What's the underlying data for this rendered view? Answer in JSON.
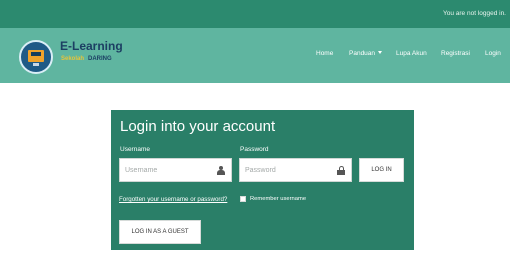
{
  "topbar": {
    "status_text": "You are not logged in."
  },
  "brand": {
    "title": "E-Learning",
    "sub1": "Sekolah",
    "sub2": "DARING"
  },
  "nav": {
    "home": "Home",
    "panduan": "Panduan",
    "lupa_akun": "Lupa Akun",
    "registrasi": "Registrasi",
    "login": "Login"
  },
  "login_card": {
    "title": "Login into your account",
    "username_label": "Username",
    "password_label": "Password",
    "username_placeholder": "Username",
    "password_placeholder": "Password",
    "login_button": "LOG IN",
    "forgot_link": "Forgotten your username or password?",
    "remember_label": "Remember username",
    "guest_button": "LOG IN AS A GUEST"
  },
  "colors": {
    "topbar": "#2c8a6f",
    "navbar": "#5fb5a0",
    "card": "#2a7f68",
    "brand_title": "#1c3f63",
    "brand_sub": "#e7c43a"
  },
  "icons": {
    "logo": "computer-graduation-cap-logo",
    "username_field_icon": "user-icon",
    "password_field_icon": "lock-icon",
    "panduan_dropdown": "caret-down-icon"
  }
}
